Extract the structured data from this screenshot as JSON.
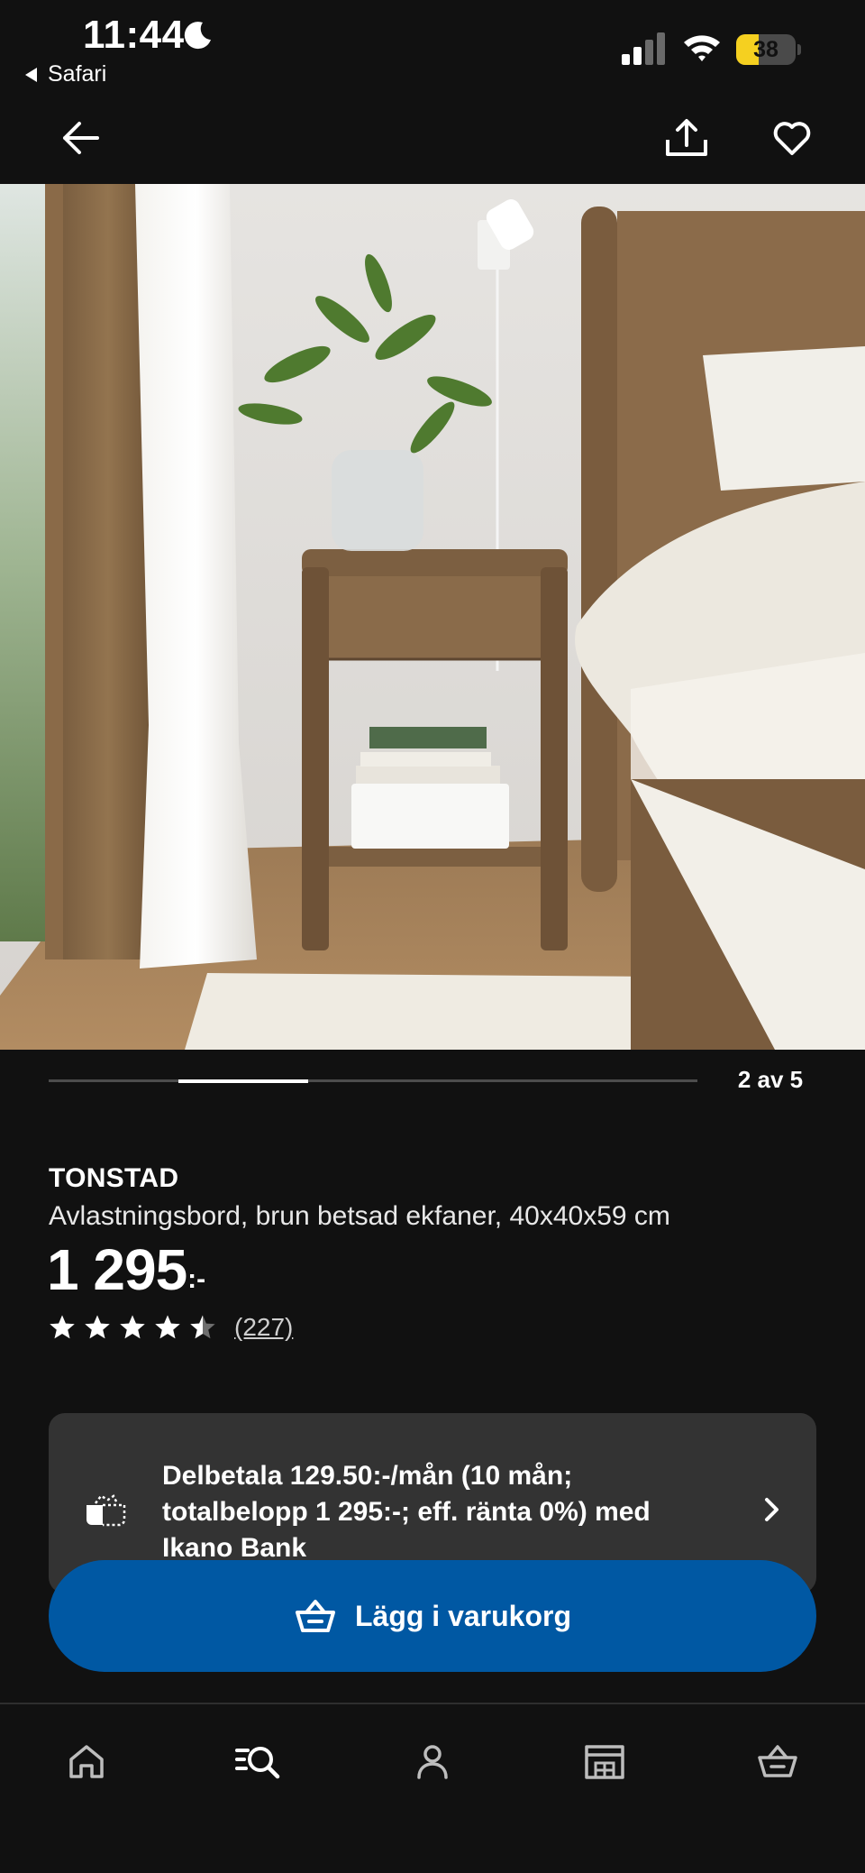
{
  "status_bar": {
    "time": "11:44",
    "back_app": "Safari",
    "battery_percent": 38,
    "icons": [
      "moon-icon",
      "signal-icon",
      "wifi-icon",
      "battery-icon"
    ]
  },
  "top_nav": {
    "icons": [
      "arrow-left-icon",
      "share-icon",
      "heart-icon"
    ]
  },
  "carousel": {
    "current": 2,
    "total": 5,
    "counter_text": "2 av 5"
  },
  "product": {
    "name": "TONSTAD",
    "description": "Avlastningsbord, brun betsad ekfaner, 40x40x59 cm",
    "price": "1 295",
    "price_suffix": ":-",
    "rating": 4.5,
    "rating_max": 5,
    "review_count": "(227)"
  },
  "installment": {
    "text": "Delbetala 129.50:-/mån (10 mån; totalbelopp 1 295:-; eff. ränta 0%) med Ikano Bank",
    "icon": "payment-icon"
  },
  "add_to_cart": {
    "label": "Lägg i varukorg",
    "color": "#0058a3"
  },
  "tab_bar": {
    "tabs": [
      "home-icon",
      "search-icon",
      "profile-icon",
      "store-icon",
      "cart-icon"
    ]
  }
}
